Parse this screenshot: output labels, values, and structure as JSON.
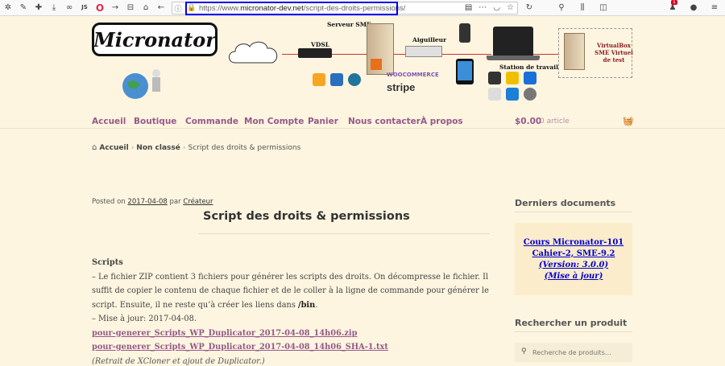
{
  "browser": {
    "url_prefix": "https://www.",
    "url_domain": "micronator-dev.net",
    "url_path": "/script-des-droits-permissions/",
    "toolbar_left_text": "JS",
    "badge_count": "1"
  },
  "brand": {
    "logo": "Micronator",
    "labels": {
      "vdsl": "VDSL",
      "server": "Serveur SME",
      "switch": "Aiguilleur",
      "workstation": "Station de travail",
      "virtualbox": "VirtualBox SME Virtuel de test",
      "stripe": "stripe",
      "woo": "WOOCOMMERCE"
    }
  },
  "nav": {
    "items": [
      "Accueil",
      "Boutique",
      "Commande",
      "Mon Compte",
      "Panier",
      "Nous contacter",
      "À propos"
    ],
    "cart_amount": "$0.00",
    "cart_count": "0 article"
  },
  "breadcrumb": {
    "home": "Accueil",
    "category": "Non classé",
    "current": "Script des droits & permissions"
  },
  "post": {
    "posted_on": "Posted on",
    "date": "2017-04-08",
    "by": "par",
    "author": "Créateur",
    "title": "Script des droits & permissions",
    "heading": "Scripts",
    "para_1": "– Le fichier ZIP contient 3 fichiers pour générer les scripts des droits. On décompresse le fichier. Il suffit de copier le contenu de chaque fichier et de le coller à la ligne de commande pour générer le script. Ensuite, il ne reste qu’à créer les liens dans ",
    "bin": "/bin",
    "para_1_end": ".",
    "update": "– Mise à jour: 2017-04-08.",
    "link_zip": "pour-generer_Scripts_WP_Duplicator_2017-04-08_14h06.zip",
    "link_sha": "pour-generer_Scripts_WP_Duplicator_2017-04-08_14h06_SHA-1.txt",
    "note": "(Retrait de XCloner et ajout de Duplicator.)"
  },
  "sidebar": {
    "docs_title": "Derniers documents",
    "doc_line1": "Cours Micronator-101",
    "doc_line2": "Cahier-2, SME-9.2",
    "doc_line3": "(Version: 3.0.0)",
    "doc_line4": "(Mise à jour)",
    "search_title": "Rechercher un produit",
    "search_placeholder": "Recherche de produits…"
  }
}
